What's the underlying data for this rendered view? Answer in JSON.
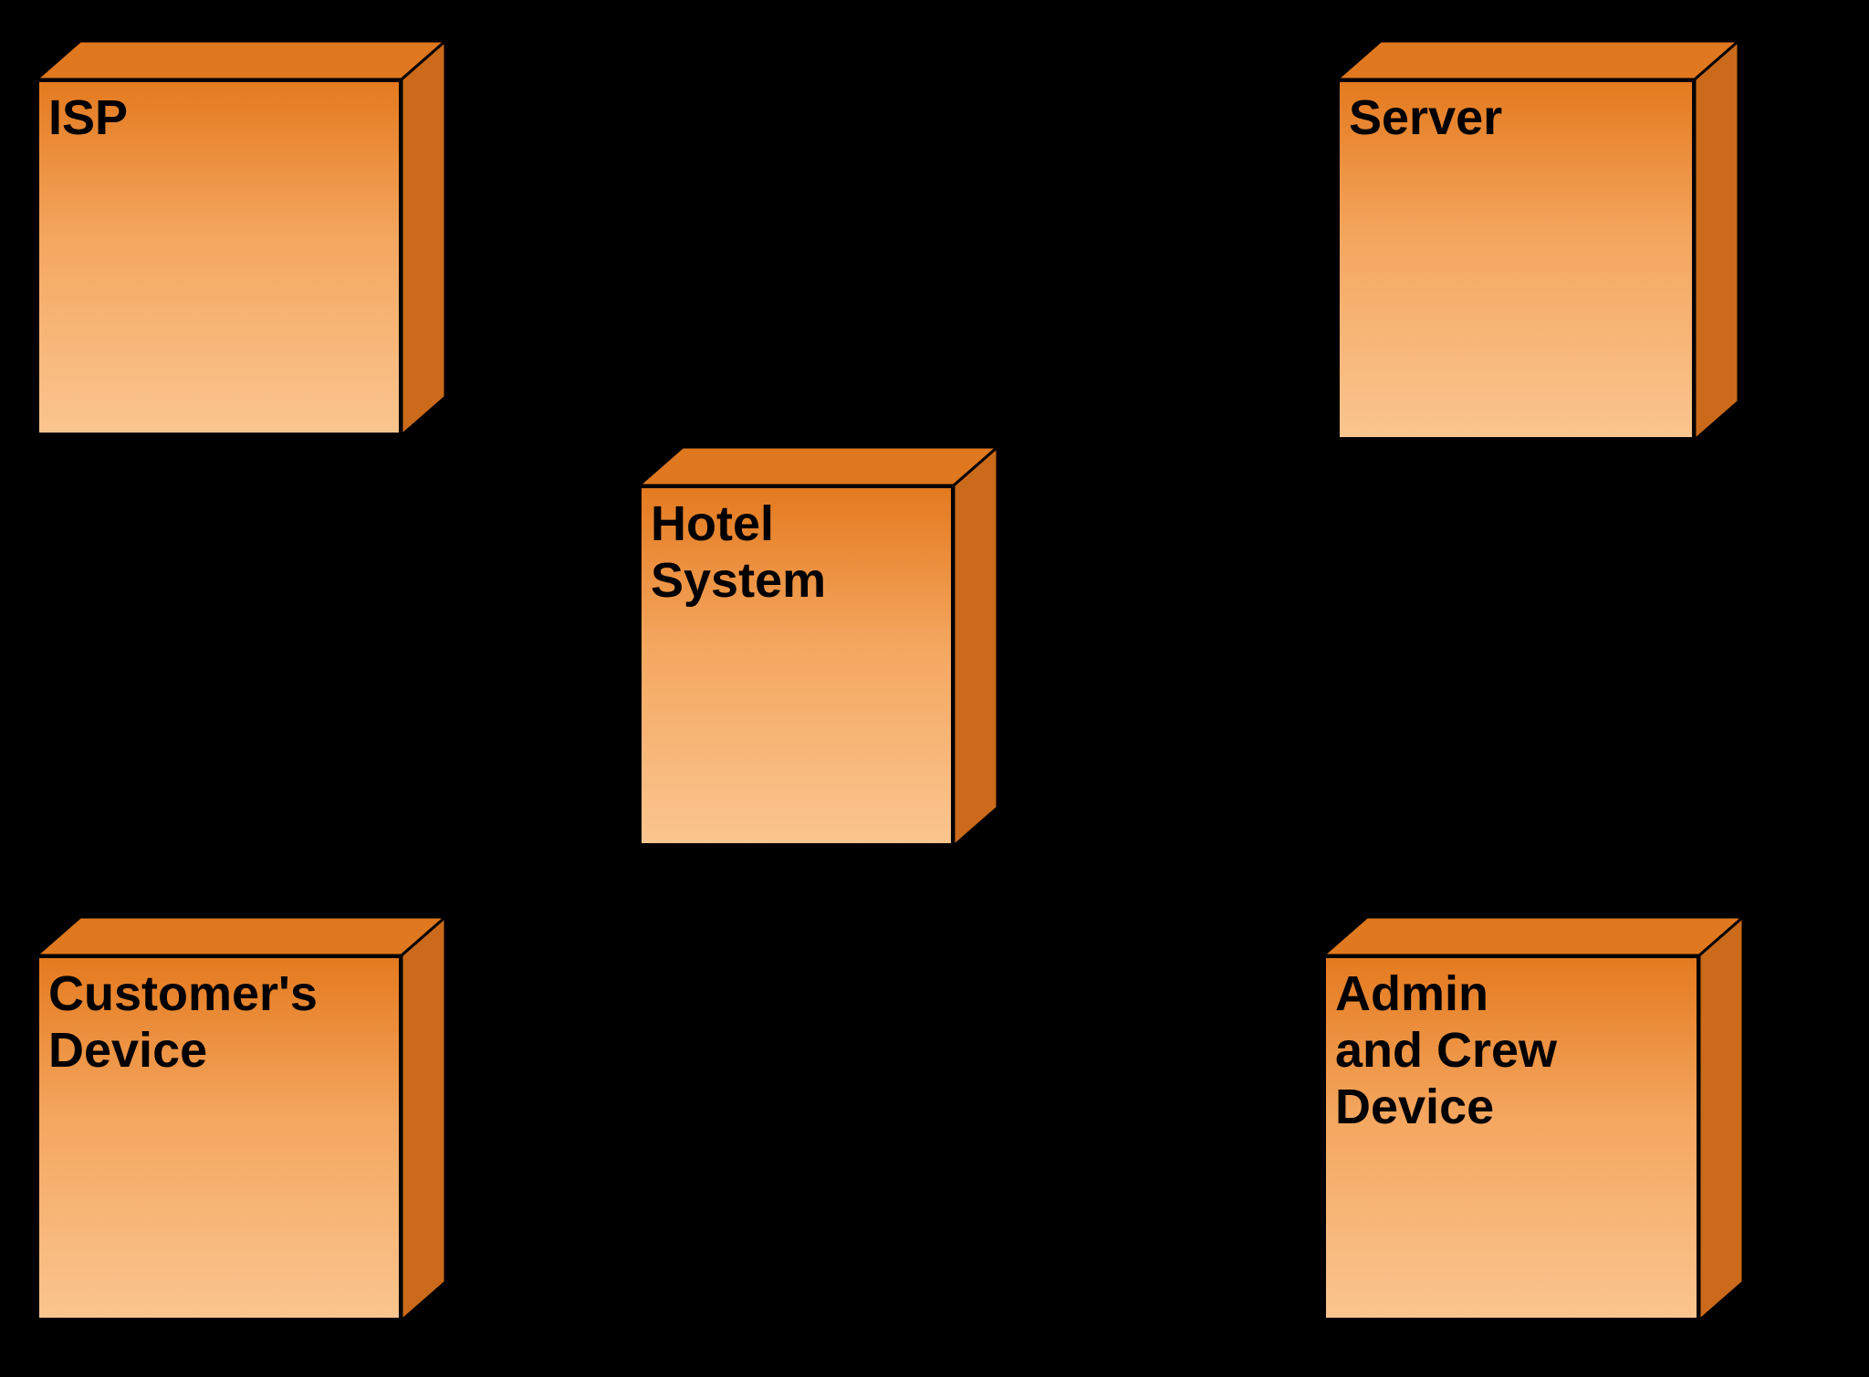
{
  "nodes": {
    "isp": {
      "label": "ISP"
    },
    "server": {
      "label": "Server"
    },
    "hotel": {
      "label": "Hotel\nSystem"
    },
    "customer": {
      "label": "Customer's\nDevice"
    },
    "admin": {
      "label": "Admin\nand Crew\nDevice"
    }
  },
  "connectors": [
    {
      "from": "isp",
      "to": "hotel"
    },
    {
      "from": "server",
      "to": "hotel"
    },
    {
      "from": "customer",
      "to": "hotel"
    },
    {
      "from": "admin",
      "to": "hotel"
    }
  ]
}
